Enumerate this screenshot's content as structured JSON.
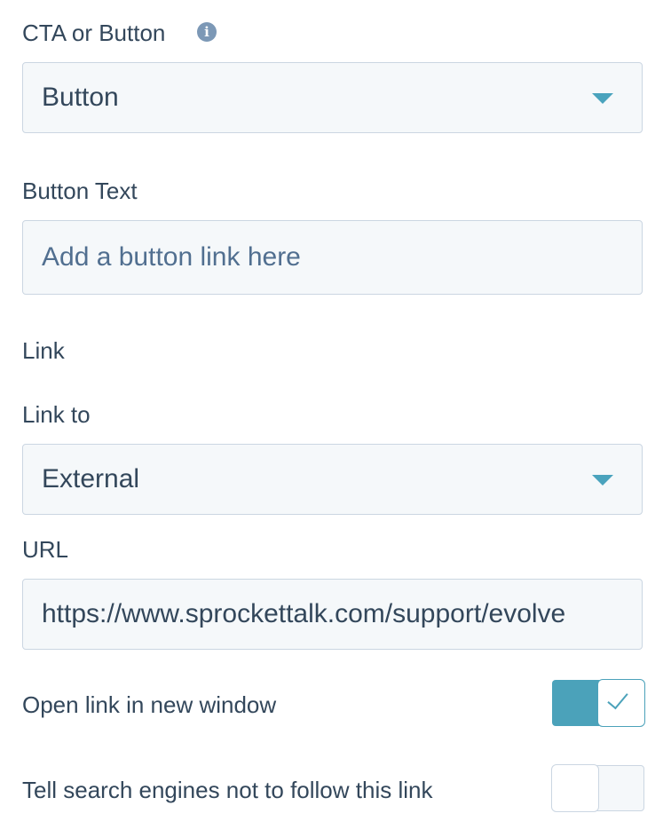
{
  "cta_type": {
    "label": "CTA or Button",
    "info_icon": "info-icon",
    "selected": "Button"
  },
  "button_text": {
    "label": "Button Text",
    "placeholder": "Add a button link here"
  },
  "link": {
    "section_label": "Link",
    "link_to_label": "Link to",
    "link_to_selected": "External",
    "url_label": "URL",
    "url_value": "https://www.sprockettalk.com/support/evolve"
  },
  "toggles": {
    "new_window": {
      "label": "Open link in new window",
      "checked": true
    },
    "nofollow": {
      "label": "Tell search engines not to follow this link",
      "checked": false
    }
  },
  "colors": {
    "accent": "#4ba2ba",
    "text": "#33475b",
    "field_bg": "#f5f8fa",
    "border": "#cbd6e2"
  }
}
